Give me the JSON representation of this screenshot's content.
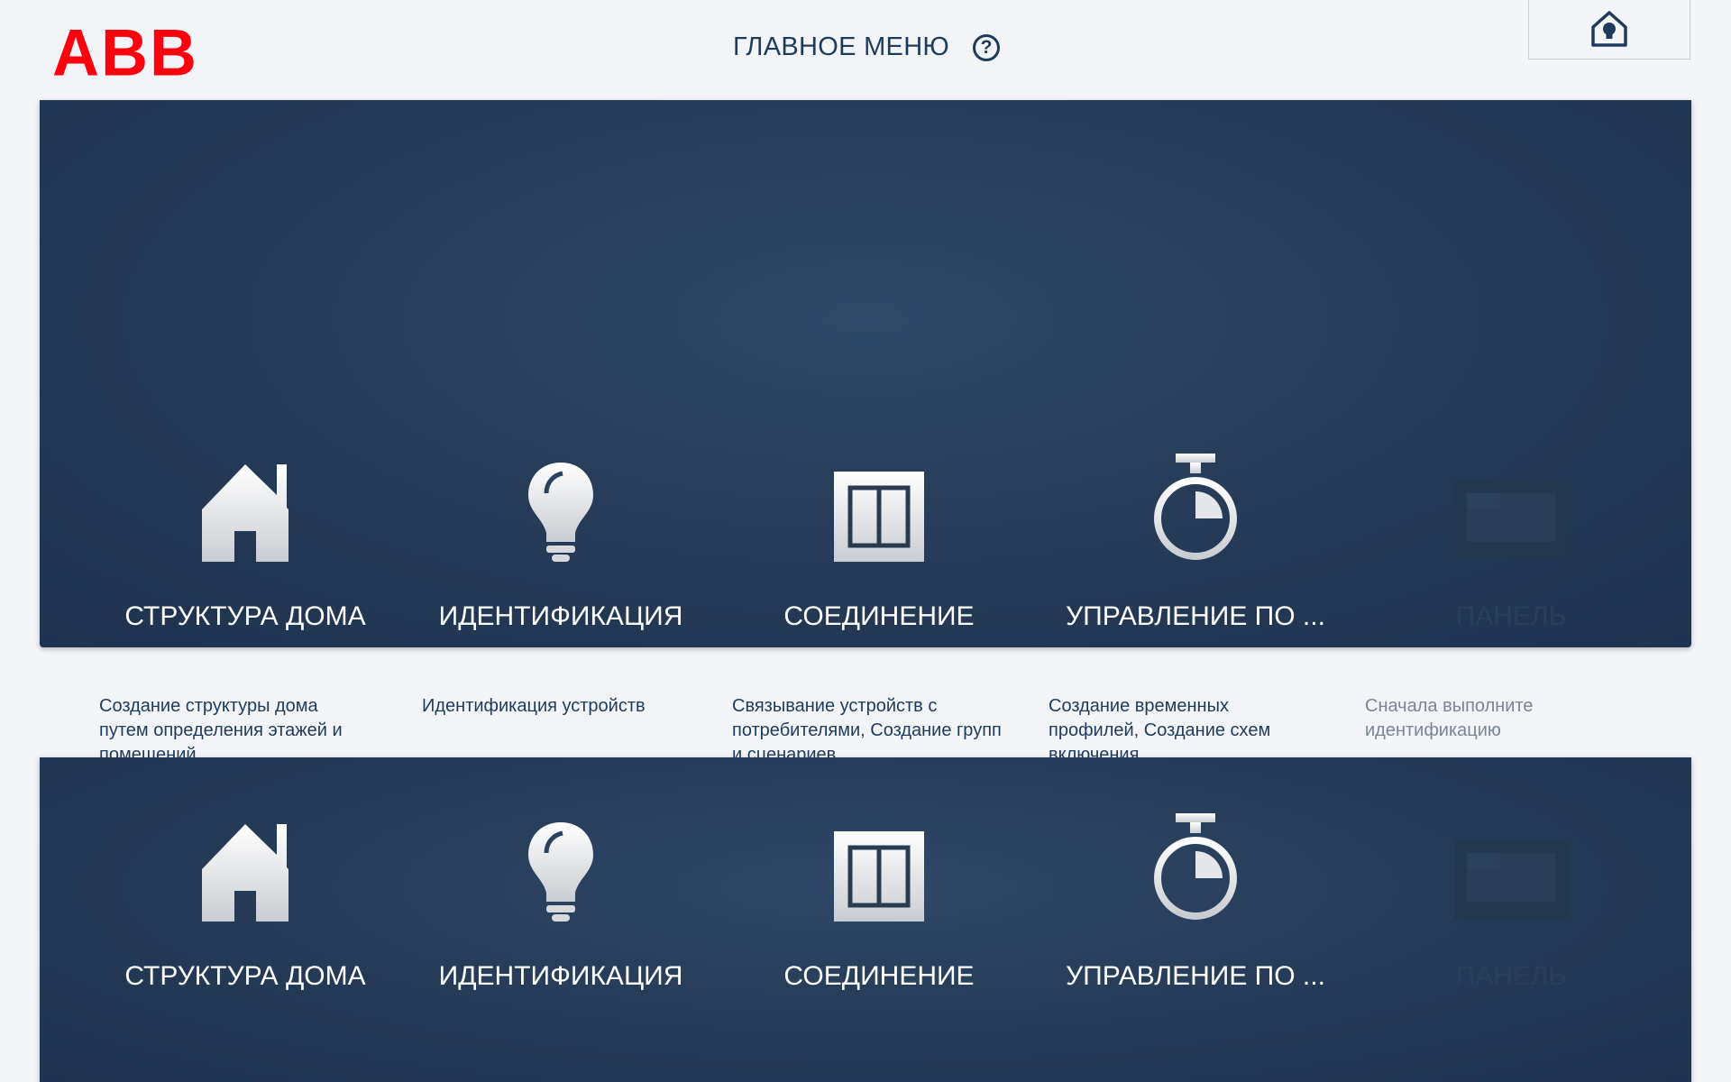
{
  "brand": {
    "logo_text": "ABB",
    "logo_color": "#ff000f"
  },
  "header": {
    "title": "ГЛАВНОЕ МЕНЮ",
    "help_icon": "question-circle-icon",
    "home_icon": "smart-home-icon"
  },
  "tiles": [
    {
      "label": "СТРУКТУРА ДОМА",
      "icon": "house-icon",
      "enabled": true,
      "description": "Создание структуры дома путем определения этажей и помещений"
    },
    {
      "label": "ИДЕНТИФИКАЦИЯ",
      "icon": "lightbulb-icon",
      "enabled": true,
      "description": "Идентификация устройств"
    },
    {
      "label": "СОЕДИНЕНИЕ",
      "icon": "switch-icon",
      "enabled": true,
      "description": "Связывание устройств с потребителями, Создание групп и сценариев"
    },
    {
      "label": "УПРАВЛЕНИЕ ПО ...",
      "icon": "stopwatch-icon",
      "enabled": true,
      "description": "Создание временных профилей, Создание схем включения"
    },
    {
      "label": "ПАНЕЛЬ",
      "icon": "panel-icon",
      "enabled": false,
      "description": "Сначала выполните идентификацию"
    }
  ],
  "colors": {
    "panel_bg": "#2a4261",
    "title_text": "#1f3b5c",
    "page_bg": "#f2f4f8"
  }
}
